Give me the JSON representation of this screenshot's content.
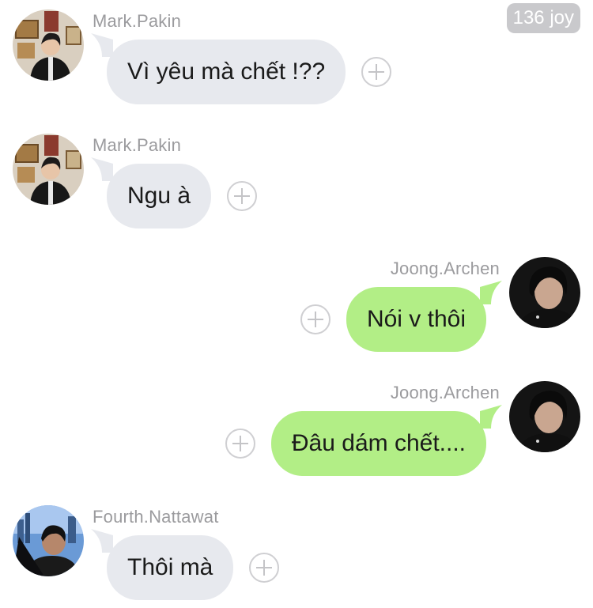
{
  "badge": {
    "label": "136 joy"
  },
  "messages": [
    {
      "sender": "Mark.Pakin",
      "text": "Vì yêu mà chết !??",
      "side": "left",
      "avatar": "mark"
    },
    {
      "sender": "Mark.Pakin",
      "text": "Ngu à",
      "side": "left",
      "avatar": "mark"
    },
    {
      "sender": "Joong.Archen",
      "text": "Nói v thôi",
      "side": "right",
      "avatar": "joong"
    },
    {
      "sender": "Joong.Archen",
      "text": "Đâu dám chết....",
      "side": "right",
      "avatar": "joong"
    },
    {
      "sender": "Fourth.Nattawat",
      "text": "Thôi mà",
      "side": "left",
      "avatar": "fourth"
    }
  ],
  "colors": {
    "incoming_bubble": "#e7e9ee",
    "outgoing_bubble": "#b2ee86",
    "name_text": "#9b9b9e",
    "badge_bg": "#c9c9cc"
  },
  "icons": {
    "add_reaction": "plus-circle-icon"
  }
}
